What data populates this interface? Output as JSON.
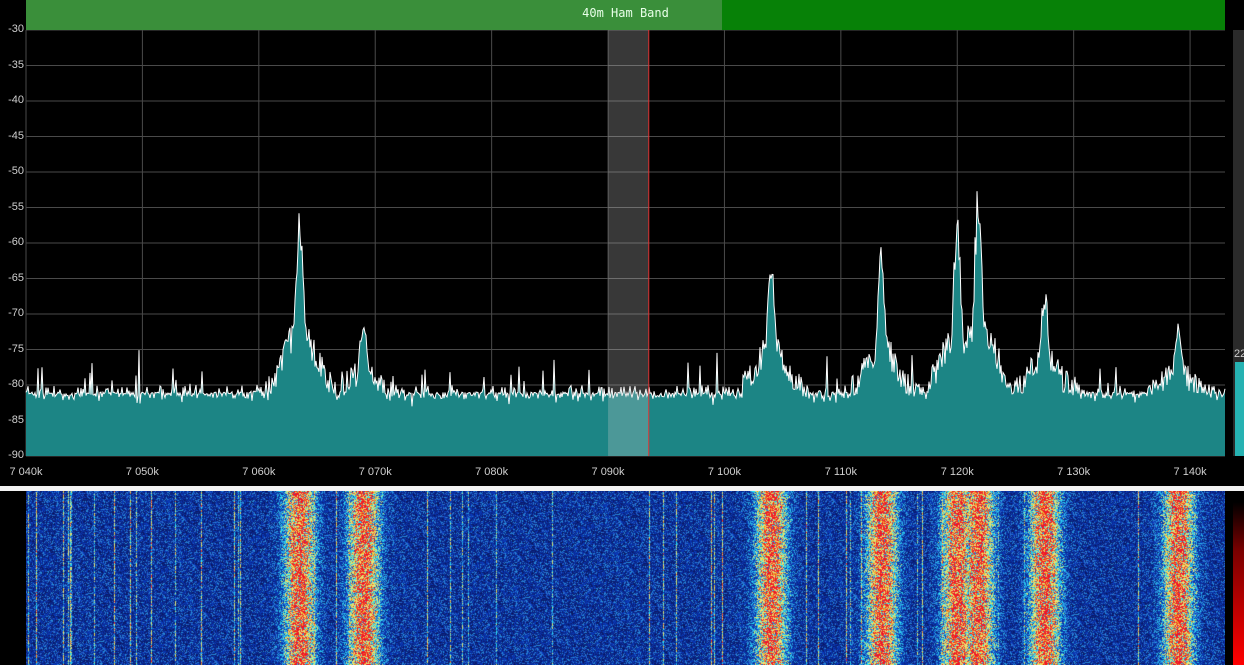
{
  "band": {
    "label": "40m Ham Band",
    "color_left": "#3a8f3a",
    "color_right": "#078107"
  },
  "spectrum": {
    "ylabels": [
      "-30",
      "-35",
      "-40",
      "-45",
      "-50",
      "-55",
      "-60",
      "-65",
      "-70",
      "-75",
      "-80",
      "-85",
      "-90"
    ],
    "xlabels": [
      "7 040k",
      "7 050k",
      "7 060k",
      "7 070k",
      "7 080k",
      "7 090k",
      "7 100k",
      "7 110k",
      "7 120k",
      "7 130k",
      "7 140k"
    ],
    "trace_color": "#1c8585",
    "passband": {
      "start_khz": 7090.0,
      "end_khz": 7093.5
    },
    "tuned_khz": 7093.5
  },
  "signal_level": {
    "label": "22"
  },
  "chart_data": {
    "type": "area",
    "xlabel": "",
    "ylabel": "",
    "xlim": [
      7040,
      7143
    ],
    "ylim": [
      -90,
      -30
    ],
    "peaks": [
      {
        "x": 7063.5,
        "y": -53
      },
      {
        "x": 7069.0,
        "y": -69
      },
      {
        "x": 7104.0,
        "y": -60
      },
      {
        "x": 7113.5,
        "y": -60
      },
      {
        "x": 7120.0,
        "y": -55
      },
      {
        "x": 7121.8,
        "y": -50
      },
      {
        "x": 7127.5,
        "y": -65
      },
      {
        "x": 7139.0,
        "y": -70
      }
    ],
    "noise_floor": -83
  }
}
